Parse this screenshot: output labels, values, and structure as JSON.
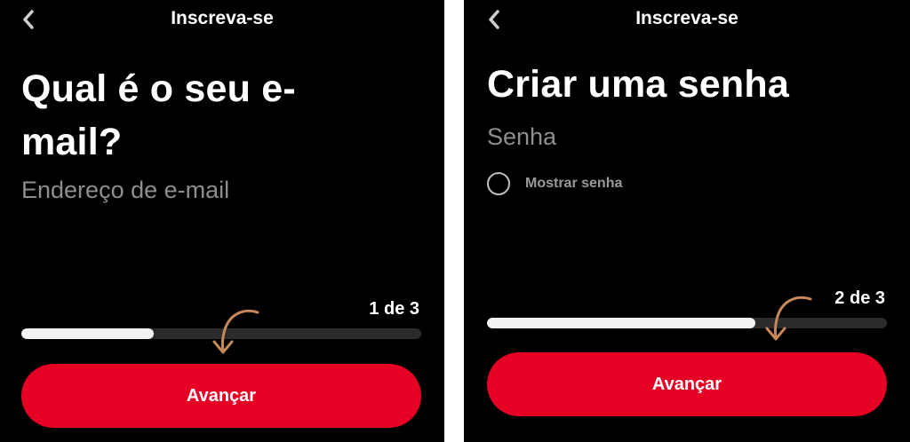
{
  "colors": {
    "background": "#000000",
    "accent": "#e60023",
    "progress_fill": "#f2f2f2",
    "progress_track": "#2b2b2b",
    "placeholder": "#8e8e8e",
    "annotation_arrow": "#c8875a"
  },
  "screens": [
    {
      "nav": {
        "back_icon": "chevron-left-icon",
        "title": "Inscreva-se"
      },
      "heading": "Qual é o seu e-mail?",
      "field": {
        "placeholder": "Endereço de e-mail",
        "value": ""
      },
      "step": {
        "label": "1 de 3",
        "progress": 0.33
      },
      "cta_label": "Avançar"
    },
    {
      "nav": {
        "back_icon": "chevron-left-icon",
        "title": "Inscreva-se"
      },
      "heading": "Criar uma senha",
      "field": {
        "placeholder": "Senha",
        "value": ""
      },
      "show_password": {
        "label": "Mostrar senha",
        "checked": false
      },
      "step": {
        "label": "2 de 3",
        "progress": 0.67
      },
      "cta_label": "Avançar"
    }
  ]
}
